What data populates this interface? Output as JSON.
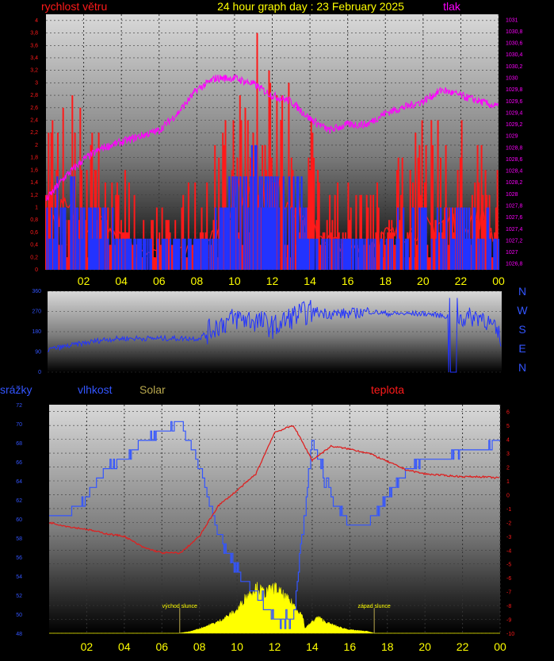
{
  "title": "24 hour graph day : 23 February 2025",
  "colors": {
    "title": "#ffff00",
    "wind": "#ff1a1a",
    "gust": "#2233ff",
    "pressure": "#ff00ff",
    "direction": "#2233ff",
    "humidity": "#3355ff",
    "temperature": "#dd2222",
    "solar": "#ffff00",
    "rain": "#3355ff"
  },
  "x_ticks": [
    "02",
    "04",
    "06",
    "08",
    "10",
    "12",
    "14",
    "16",
    "18",
    "20",
    "22",
    "00"
  ],
  "chart_data": [
    {
      "type": "line",
      "name": "wind-pressure",
      "left_label": "rychlost větru",
      "right_label": "tlak",
      "y_left_ticks": [
        "0",
        "0,2",
        "0,4",
        "0,6",
        "0,8",
        "1",
        "1,2",
        "1,4",
        "1,6",
        "1,8",
        "2",
        "2,2",
        "2,4",
        "2,6",
        "2,8",
        "3",
        "3,2",
        "3,4",
        "3,6",
        "3,8",
        "4"
      ],
      "ylim_left": [
        0,
        4.1
      ],
      "y_right_ticks": [
        "1026,8",
        "1027",
        "1027,2",
        "1027,4",
        "1027,6",
        "1027,8",
        "1028",
        "1028,2",
        "1028,4",
        "1028,6",
        "1028,8",
        "1029",
        "1029,2",
        "1029,4",
        "1029,6",
        "1029,8",
        "1030",
        "1030,2",
        "1030,4",
        "1030,6",
        "1030,8",
        "1031"
      ],
      "ylim_right": [
        1026.7,
        1031.1
      ],
      "xlim_hours": [
        0,
        24
      ],
      "pressure": {
        "x": [
          0,
          1,
          2,
          3,
          4,
          5,
          6,
          7,
          8,
          9,
          10,
          11,
          12,
          13,
          14,
          15,
          16,
          17,
          18,
          19,
          20,
          21,
          22,
          23,
          24
        ],
        "y": [
          1027.9,
          1028.3,
          1028.6,
          1028.8,
          1028.9,
          1029.0,
          1029.1,
          1029.4,
          1029.8,
          1030.0,
          1030.0,
          1029.9,
          1029.7,
          1029.6,
          1029.3,
          1029.1,
          1029.2,
          1029.2,
          1029.4,
          1029.5,
          1029.6,
          1029.8,
          1029.7,
          1029.6,
          1029.5
        ]
      },
      "wind": {
        "x": [
          0,
          1,
          2,
          3,
          4,
          5,
          6,
          7,
          8,
          9,
          10,
          11,
          12,
          13,
          14,
          15,
          16,
          17,
          18,
          19,
          20,
          21,
          22,
          23,
          24
        ],
        "avg": [
          0.9,
          1.0,
          0.8,
          0.8,
          0.5,
          0.3,
          0.3,
          0.3,
          0.4,
          0.6,
          1.2,
          1.5,
          1.3,
          1.2,
          0.7,
          0.5,
          0.4,
          0.4,
          0.6,
          0.6,
          0.7,
          0.8,
          0.8,
          0.9,
          0.5
        ],
        "peak": [
          2.8,
          3.3,
          2.6,
          2.4,
          1.8,
          1.2,
          1.0,
          1.1,
          1.6,
          2.3,
          2.9,
          4.1,
          3.4,
          3.2,
          2.4,
          1.7,
          1.4,
          1.3,
          2.0,
          2.1,
          2.4,
          2.6,
          2.7,
          2.4,
          1.8
        ],
        "gust": [
          0.6,
          1.1,
          0.8,
          0.7,
          0.5,
          0.3,
          0.3,
          0.3,
          0.4,
          0.6,
          1.1,
          1.5,
          1.1,
          1.2,
          0.6,
          0.5,
          0.4,
          0.4,
          0.6,
          0.6,
          0.7,
          0.8,
          0.8,
          0.7,
          0.6
        ]
      }
    },
    {
      "type": "line",
      "name": "wind-direction",
      "y_ticks": [
        "0",
        "90",
        "180",
        "270",
        "360"
      ],
      "ylim": [
        0,
        360
      ],
      "compass": [
        "N",
        "W",
        "S",
        "E",
        "N"
      ],
      "x": [
        0,
        1,
        2,
        3,
        4,
        5,
        6,
        7,
        8,
        9,
        10,
        11,
        12,
        13,
        14,
        15,
        16,
        17,
        18,
        19,
        20,
        21,
        22,
        23,
        24
      ],
      "y": [
        100,
        115,
        130,
        145,
        150,
        150,
        150,
        150,
        150,
        210,
        240,
        230,
        200,
        250,
        270,
        260,
        260,
        270,
        260,
        260,
        260,
        250,
        240,
        250,
        150
      ]
    },
    {
      "type": "line",
      "name": "humidity-temperature-solar",
      "labels": {
        "rain": "srážky",
        "humidity": "vlhkost",
        "solar": "Solar",
        "temperature": "teplota"
      },
      "y_left_ticks": [
        "48",
        "50",
        "52",
        "54",
        "56",
        "58",
        "60",
        "62",
        "64",
        "66",
        "68",
        "70",
        "72"
      ],
      "ylim_left": [
        48,
        72
      ],
      "y_right_ticks": [
        "-10",
        "-9",
        "-8",
        "-7",
        "-6",
        "-5",
        "-4",
        "-3",
        "-2",
        "-1",
        "0",
        "1",
        "2",
        "3",
        "4",
        "5",
        "6"
      ],
      "ylim_right": [
        -10,
        6.5
      ],
      "humidity_ylim": [
        47.5,
        71.8
      ],
      "annotations": [
        {
          "text": "východ slunce",
          "hour": 6.95
        },
        {
          "text": "západ slunce",
          "hour": 17.3
        }
      ],
      "temperature": {
        "x": [
          0,
          1,
          2,
          3,
          4,
          5,
          6,
          7,
          8,
          9,
          10,
          11,
          12,
          13,
          14,
          15,
          16,
          17,
          18,
          19,
          20,
          21,
          22,
          23,
          24
        ],
        "y": [
          -2.0,
          -2.3,
          -2.5,
          -2.8,
          -3.0,
          -3.8,
          -4.2,
          -4.2,
          -3.0,
          -0.8,
          0.3,
          1.5,
          4.5,
          5.0,
          2.5,
          3.5,
          3.3,
          3.0,
          2.4,
          1.8,
          1.5,
          1.4,
          1.3,
          1.3,
          1.2
        ]
      },
      "humidity": {
        "x": [
          0,
          1,
          2,
          3,
          4,
          5,
          6,
          7,
          8,
          9,
          10,
          11,
          12,
          13,
          14,
          15,
          16,
          17,
          18,
          19,
          20,
          21,
          22,
          23,
          24
        ],
        "y": [
          60,
          60,
          62,
          65,
          66,
          68,
          69,
          70,
          65,
          58,
          54,
          52,
          49,
          49,
          68,
          62,
          59,
          59,
          62,
          65,
          66,
          66,
          67,
          67,
          68
        ]
      },
      "solar": {
        "x": [
          0,
          6.9,
          7.5,
          8,
          9,
          10,
          10.5,
          11,
          11.5,
          12,
          12.5,
          13,
          13.5,
          13.6,
          14,
          14.3,
          14.8,
          15.5,
          16,
          17,
          17.3,
          18,
          24
        ],
        "y": [
          0,
          0,
          0.3,
          0.8,
          2.0,
          4.0,
          6.5,
          8.0,
          7.0,
          8.0,
          6.5,
          5.0,
          3.0,
          0.8,
          2.0,
          2.8,
          1.8,
          1.0,
          0.6,
          0.3,
          0,
          0,
          0
        ]
      }
    }
  ]
}
